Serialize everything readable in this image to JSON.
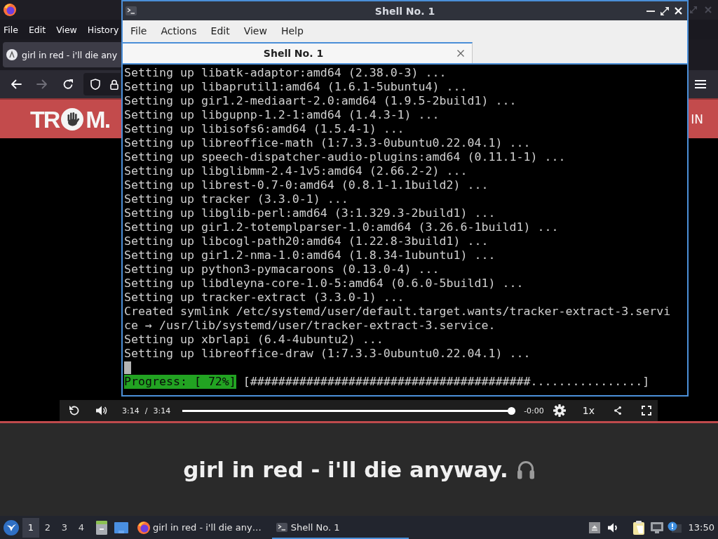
{
  "browser": {
    "menu": [
      "File",
      "Edit",
      "View",
      "History"
    ],
    "tab": {
      "title": "girl in red - i'll die any"
    },
    "navigation": {
      "back": {
        "disabled": false
      },
      "forward": {
        "disabled": true
      }
    },
    "banner": {
      "logo_start": "TR",
      "logo_end": "M.",
      "link": "IN"
    },
    "player": {
      "elapsed": "3:14",
      "separator": "/",
      "duration": "3:14",
      "seek": {
        "level": 1
      },
      "remaining": "-0:00",
      "speed": "1x"
    },
    "video_title": "girl in red - i'll die anyway."
  },
  "terminal": {
    "title": "Shell No. 1",
    "menu": [
      "File",
      "Actions",
      "Edit",
      "View",
      "Help"
    ],
    "tabs": [
      {
        "label": "Shell No. 1",
        "selected": true
      }
    ],
    "lines": [
      "Setting up libatk-adaptor:amd64 (2.38.0-3) ...",
      "Setting up libaprutil1:amd64 (1.6.1-5ubuntu4) ...",
      "Setting up gir1.2-mediaart-2.0:amd64 (1.9.5-2build1) ...",
      "Setting up libgupnp-1.2-1:amd64 (1.4.3-1) ...",
      "Setting up libisofs6:amd64 (1.5.4-1) ...",
      "Setting up libreoffice-math (1:7.3.3-0ubuntu0.22.04.1) ...",
      "Setting up speech-dispatcher-audio-plugins:amd64 (0.11.1-1) ...",
      "Setting up libglibmm-2.4-1v5:amd64 (2.66.2-2) ...",
      "Setting up librest-0.7-0:amd64 (0.8.1-1.1build2) ...",
      "Setting up tracker (3.3.0-1) ...",
      "Setting up libglib-perl:amd64 (3:1.329.3-2build1) ...",
      "Setting up gir1.2-totemplparser-1.0:amd64 (3.26.6-1build1) ...",
      "Setting up libcogl-path20:amd64 (1.22.8-3build1) ...",
      "Setting up gir1.2-nma-1.0:amd64 (1.8.34-1ubuntu1) ...",
      "Setting up python3-pymacaroons (0.13.0-4) ...",
      "Setting up libdleyna-core-1.0-5:amd64 (0.6.0-5build1) ...",
      "Setting up tracker-extract (3.3.0-1) ...",
      "Created symlink /etc/systemd/user/default.target.wants/tracker-extract-3.servi",
      "ce → /usr/lib/systemd/user/tracker-extract-3.service.",
      "Setting up xbrlapi (6.4-4ubuntu2) ...",
      "Setting up libreoffice-draw (1:7.3.3-0ubuntu0.22.04.1) ..."
    ],
    "cursor": true,
    "progress": {
      "label": "Progress: [ 72%]",
      "bar": "[########################################................]"
    }
  },
  "taskbar": {
    "workspaces": [
      {
        "label": "1",
        "selected": true
      },
      {
        "label": "2",
        "selected": false
      },
      {
        "label": "3",
        "selected": false
      },
      {
        "label": "4",
        "selected": false
      }
    ],
    "tasks": [
      {
        "kind": "browser",
        "label": "girl in red - i'll die any…",
        "selected": false
      },
      {
        "kind": "terminal",
        "label": "Shell No. 1",
        "selected": true
      }
    ],
    "clock": "13:50"
  }
}
